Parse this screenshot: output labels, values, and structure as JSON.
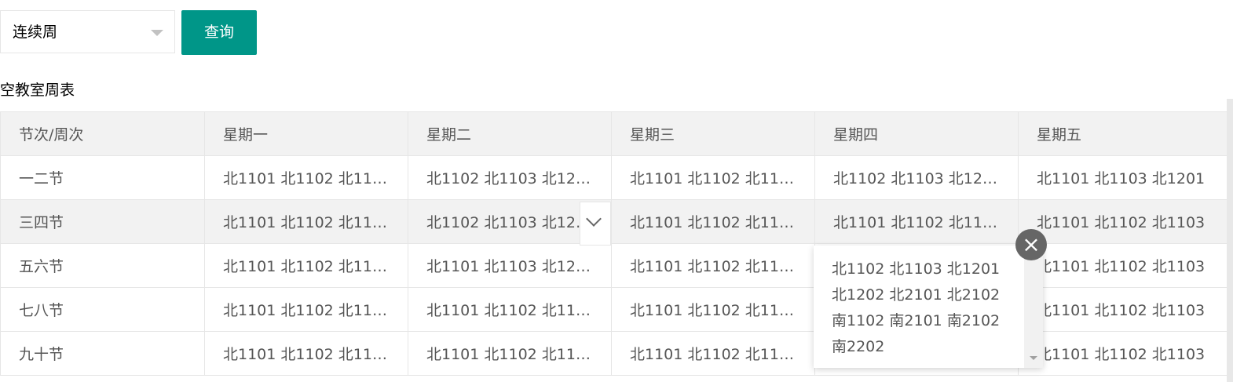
{
  "filter": {
    "selected": "连续周",
    "query_button": "查询"
  },
  "table_title": "空教室周表",
  "headers": [
    "节次/周次",
    "星期一",
    "星期二",
    "星期三",
    "星期四",
    "星期五"
  ],
  "rows": [
    [
      "一二节",
      "北1101 北1102 北11…",
      "北1102 北1103 北12…",
      "北1101 北1102 北11…",
      "北1102 北1103 北12…",
      "北1101 北1103 北1201"
    ],
    [
      "三四节",
      "北1101 北1102 北11…",
      "北1102 北1103 北12…",
      "北1101 北1102 北11…",
      "北1101 北1102 北11…",
      "北1101 北1102 北1103"
    ],
    [
      "五六节",
      "北1101 北1102 北11…",
      "北1101 北1103 北12…",
      "北1101 北1102 北11…",
      "",
      "北1101 北1102 北1103"
    ],
    [
      "七八节",
      "北1101 北1102 北11…",
      "北1101 北1102 北11…",
      "北1101 北1102 北11…",
      "",
      "北1101 北1102 北1103"
    ],
    [
      "九十节",
      "北1101 北1102 北11…",
      "北1101 北1102 北11…",
      "北1101 北1102 北11…",
      "",
      "北1101 北1102 北1103"
    ]
  ],
  "popup": {
    "lines": [
      "北1102 北1103 北1201",
      "北1202 北2101 北2102",
      "南1102 南2101 南2102",
      "南2202"
    ],
    "close_symbol": "×"
  },
  "icons": {
    "dropdown": "caret-down-icon",
    "expand": "chevron-down-icon",
    "close": "close-icon"
  },
  "colors": {
    "primary": "#009688",
    "header_bg": "#f2f2f2",
    "close_bg": "#666666"
  }
}
